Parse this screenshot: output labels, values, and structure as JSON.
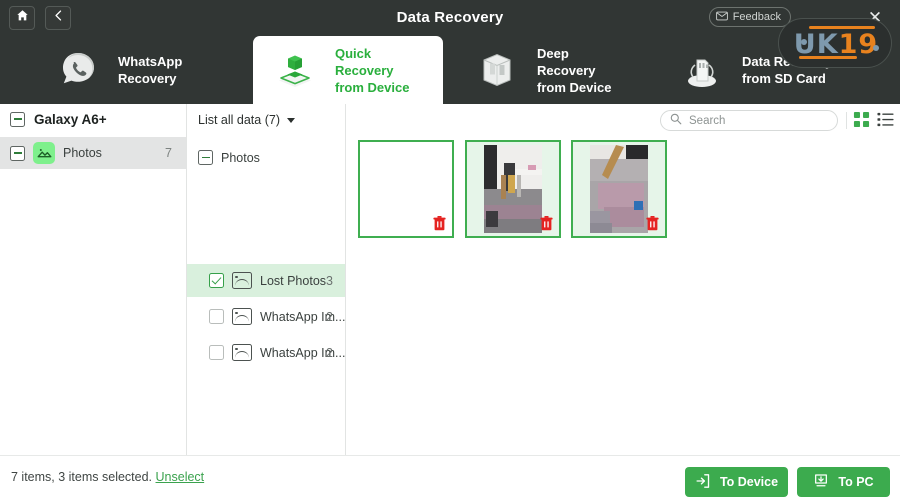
{
  "window": {
    "title": "Data Recovery",
    "home_icon": "home-icon",
    "back_icon": "chevron-left-icon",
    "feedback_label": "Feedback",
    "feedback_icon": "envelope-icon",
    "minimize": "—",
    "maximize": "—",
    "close": "✕"
  },
  "watermark": {
    "text_primary": "UK",
    "text_accent": "19",
    "color_primary": "#7e99ad",
    "color_accent": "#e8821e"
  },
  "tabs": [
    {
      "id": "whatsapp-recovery",
      "line1": "WhatsApp",
      "line2": "Recovery",
      "icon": "whatsapp-phone-icon",
      "active": false
    },
    {
      "id": "quick-recovery-from-device",
      "line1": "Quick Recovery",
      "line2": "from Device",
      "icon": "green-cube-icon",
      "active": true
    },
    {
      "id": "deep-recovery-from-device",
      "line1": "Deep Recovery",
      "line2": "from Device",
      "icon": "open-box-icon",
      "active": false
    },
    {
      "id": "data-recovery-from-sd-card",
      "line1": "Data Recovery",
      "line2": "from SD Card",
      "icon": "sd-card-icon",
      "active": false
    }
  ],
  "sidebar": {
    "device_name": "Galaxy A6+",
    "device_toggle_icon": "minus-box-icon",
    "items": [
      {
        "label": "Photos",
        "count": "7",
        "icon": "image-icon",
        "toggle_icon": "minus-box-icon",
        "selected": true
      }
    ]
  },
  "middle": {
    "header_label": "List all data (7)",
    "header_caret": "chevron-down-icon",
    "root": {
      "label": "Photos",
      "checkbox": "minus-box-icon"
    },
    "rows": [
      {
        "label": "Lost Photos",
        "count": "3",
        "checkbox": "checked",
        "icon": "image-icon",
        "selected": true
      },
      {
        "label": "WhatsApp Im...",
        "count": "2",
        "checkbox": "unchecked",
        "icon": "image-icon",
        "selected": false
      },
      {
        "label": "WhatsApp Im...",
        "count": "2",
        "checkbox": "unchecked",
        "icon": "image-icon",
        "selected": false
      }
    ]
  },
  "toolbar": {
    "search_placeholder": "Search",
    "search_value": "",
    "search_icon": "search-icon",
    "grid_view_icon": "grid-view-icon",
    "list_view_icon": "list-view-icon",
    "active_view": "grid",
    "grid_icon_color": "#3cab4e",
    "list_icon_color": "#3a403e"
  },
  "thumbnails": [
    {
      "id": "thumb-1",
      "content": "blank",
      "selected": true,
      "badge": "trash-icon"
    },
    {
      "id": "thumb-2",
      "content": "room-interior-photo",
      "selected": true,
      "badge": "trash-icon"
    },
    {
      "id": "thumb-3",
      "content": "floor-broom-photo",
      "selected": true,
      "badge": "trash-icon"
    }
  ],
  "footer": {
    "status_text": "7 items, 3 items selected.",
    "unselect_label": "Unselect",
    "to_device_label": "To Device",
    "to_device_icon": "export-to-device-icon",
    "to_pc_label": "To PC",
    "to_pc_icon": "download-to-pc-icon",
    "button_color": "#3cab4e"
  }
}
